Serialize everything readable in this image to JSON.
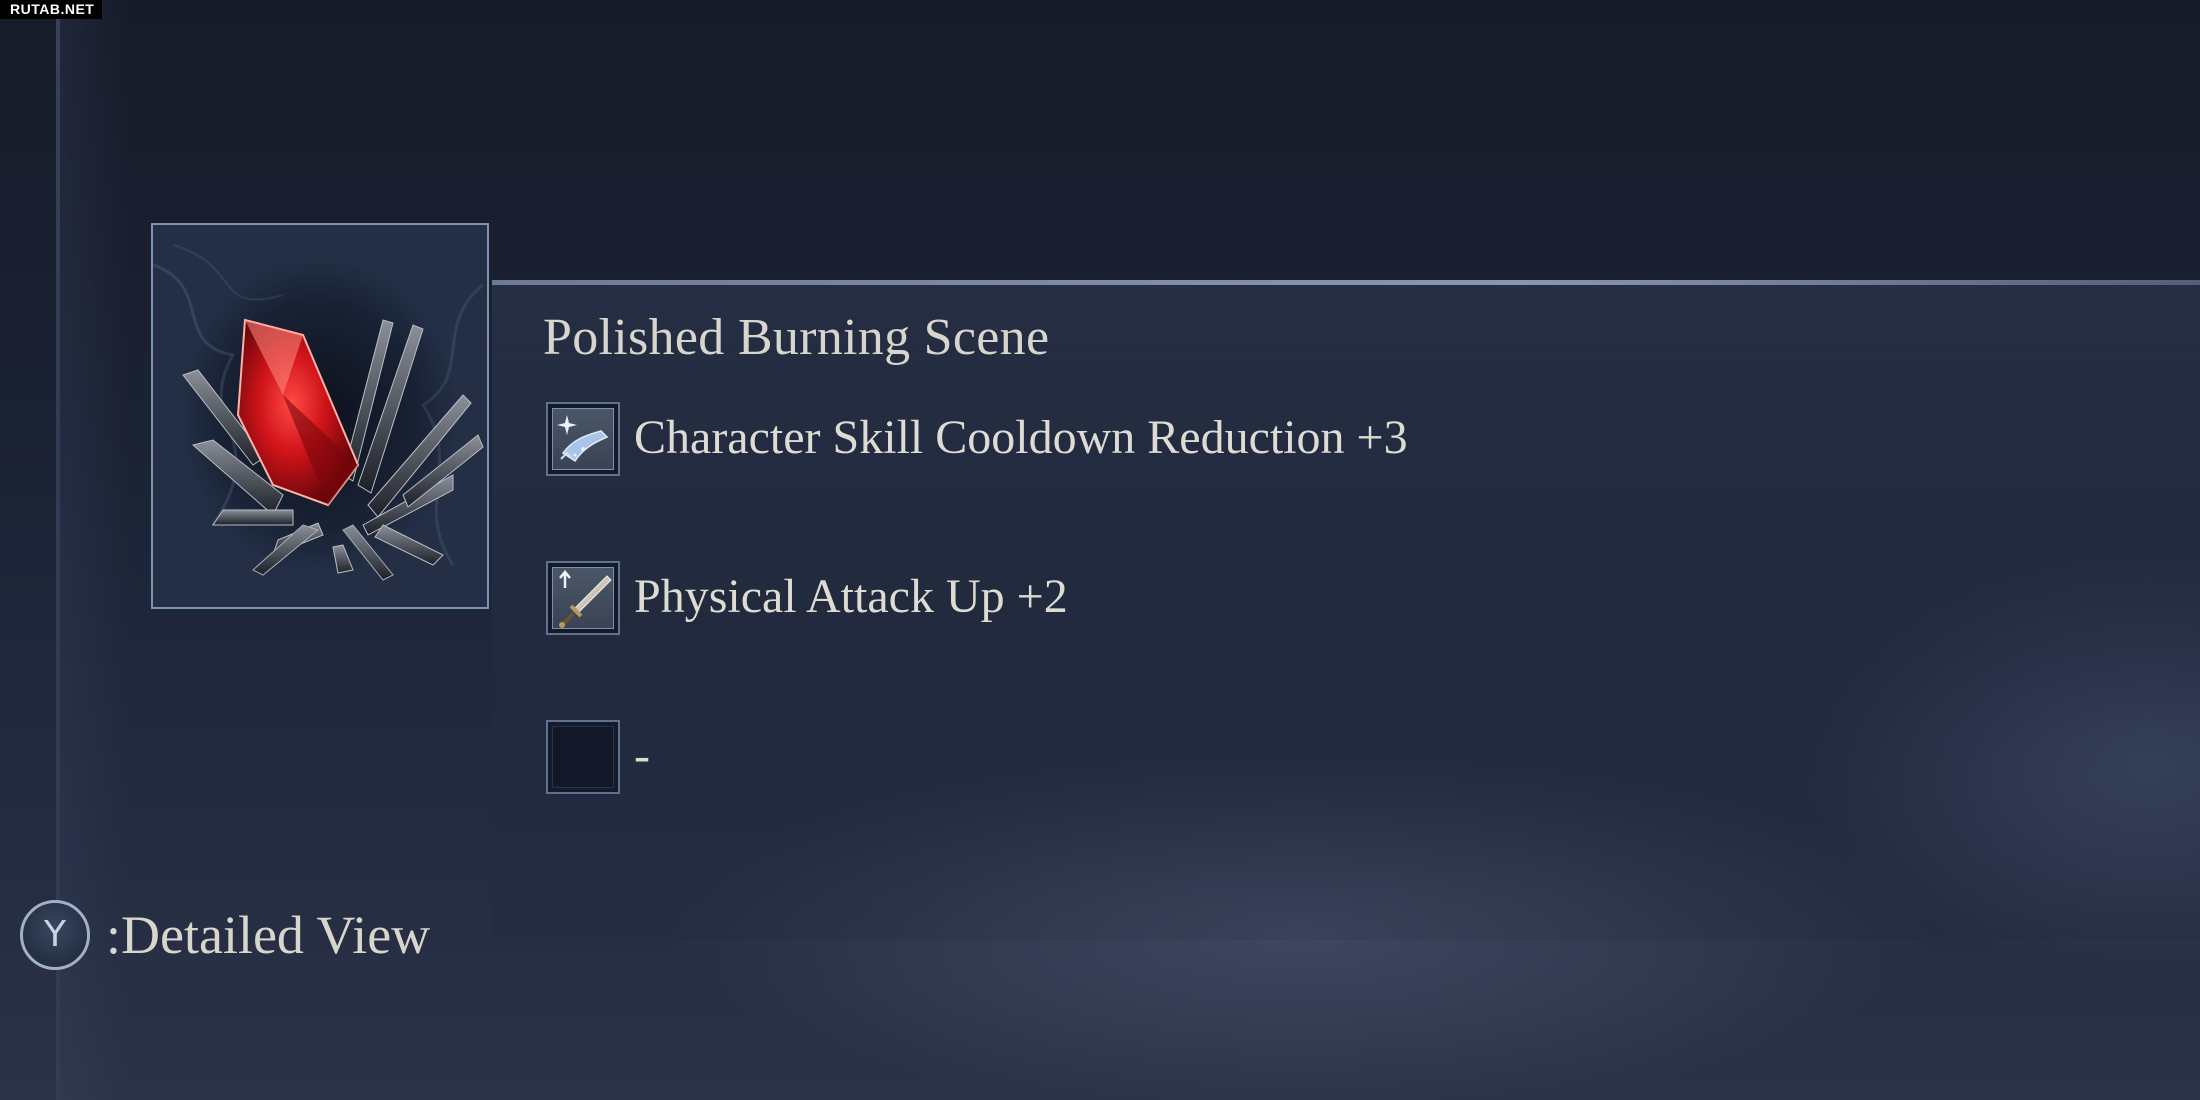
{
  "watermark": "RUTAB.NET",
  "item": {
    "name": "Polished Burning Scene",
    "icon": "red-crystal-relic-icon"
  },
  "effects": [
    {
      "text": "Character Skill Cooldown Reduction +3",
      "icon": "skill-cooldown-icon"
    },
    {
      "text": "Physical Attack Up +2",
      "icon": "sword-attack-up-icon"
    },
    {
      "text": "-",
      "icon": "empty-slot-icon"
    }
  ],
  "controls": {
    "button_glyph": "Y",
    "button_label": ":Detailed View"
  },
  "colors": {
    "background": "#1b2234",
    "text": "#dedcd2",
    "frame_border": "#7d93b3",
    "crystal": "#c8141c"
  }
}
